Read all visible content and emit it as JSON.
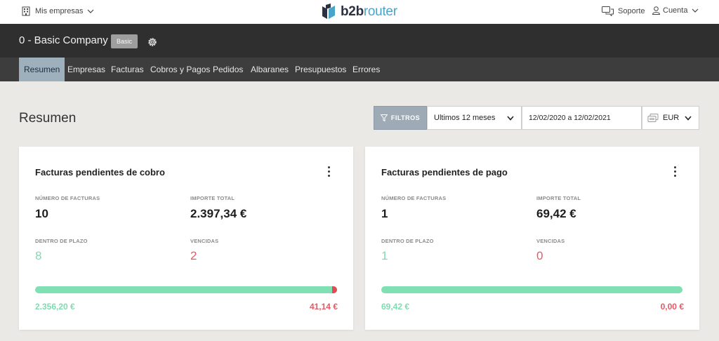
{
  "topbar": {
    "companies_label": "Mis empresas",
    "logo_b2b": "b2b",
    "logo_router": "router",
    "support_label": "Soporte",
    "account_label": "Cuenta"
  },
  "company": {
    "name": "0 - Basic Company",
    "plan": "Basic"
  },
  "nav": {
    "items": [
      "Resumen",
      "Empresas",
      "Facturas",
      "Cobros y Pagos",
      "Pedidos",
      "Albaranes",
      "Presupuestos",
      "Errores"
    ],
    "active": "Resumen"
  },
  "page": {
    "title": "Resumen",
    "filters_label": "FILTROS",
    "period": "Ultimos 12 meses",
    "date_range": "12/02/2020 a 12/02/2021",
    "currency": "EUR"
  },
  "cards": [
    {
      "title": "Facturas pendientes de cobro",
      "count_label": "NÚMERO DE FACTURAS",
      "count": "10",
      "total_label": "IMPORTE TOTAL",
      "total": "2.397,34 €",
      "ontime_label": "DENTRO DE PLAZO",
      "ontime": "8",
      "overdue_label": "VENCIDAS",
      "overdue": "2",
      "ontime_amount": "2.356,20 €",
      "overdue_amount": "41,14 €",
      "overdue_fraction": 0.0172
    },
    {
      "title": "Facturas pendientes de pago",
      "count_label": "NÚMERO DE FACTURAS",
      "count": "1",
      "total_label": "IMPORTE TOTAL",
      "total": "69,42 €",
      "ontime_label": "DENTRO DE PLAZO",
      "ontime": "1",
      "overdue_label": "VENCIDAS",
      "overdue": "0",
      "ontime_amount": "69,42 €",
      "overdue_amount": "0,00 €",
      "overdue_fraction": 0
    }
  ],
  "colors": {
    "accent_green": "#7fdcb1",
    "accent_red": "#e55a65",
    "nav_active": "#9fb0bd"
  },
  "icons": [
    "building-icon",
    "chevron-down-icon",
    "b2brouter-logo-icon",
    "chat-icon",
    "user-icon",
    "gear-icon",
    "filter-icon",
    "coins-icon",
    "kebab-menu-icon"
  ]
}
